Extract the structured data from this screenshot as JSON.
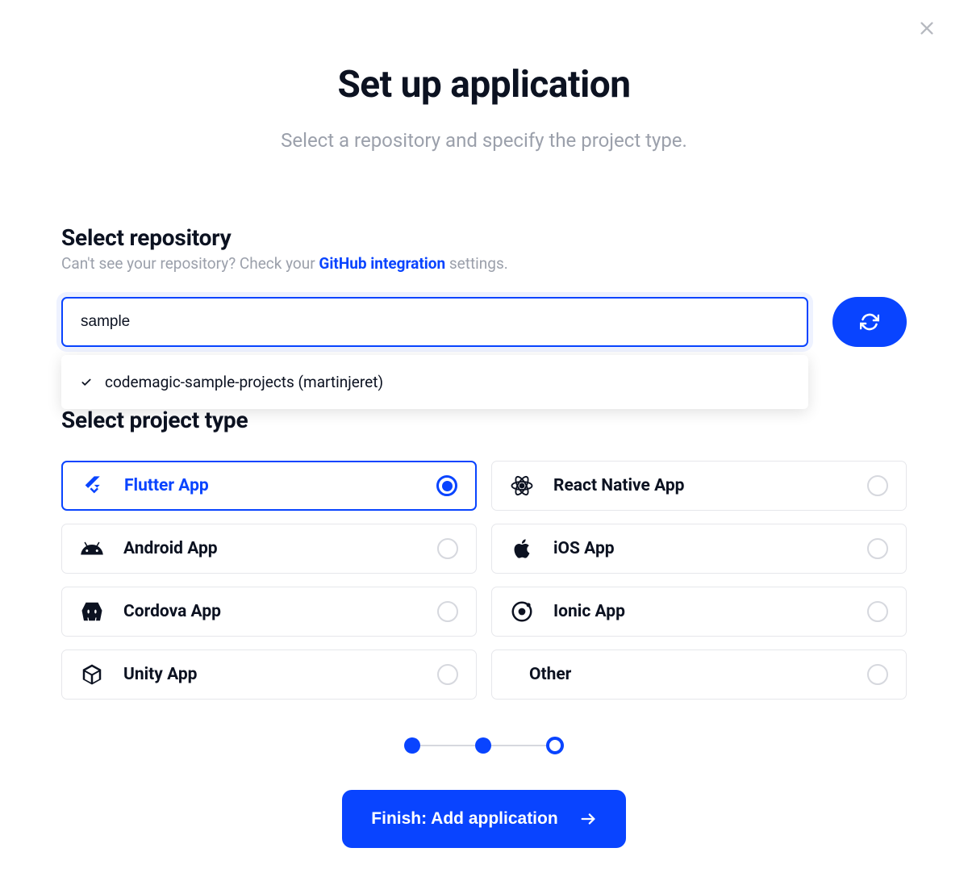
{
  "header": {
    "title": "Set up application",
    "subtitle": "Select a repository and specify the project type."
  },
  "repo": {
    "title": "Select repository",
    "help_prefix": "Can't see your repository? Check your ",
    "help_link": "GitHub integration",
    "help_suffix": " settings.",
    "input_value": "sample",
    "placeholder": "",
    "dropdown": [
      {
        "label": "codemagic-sample-projects (martinjeret)",
        "selected": true
      }
    ]
  },
  "project_type": {
    "title": "Select project type",
    "options": [
      {
        "icon": "flutter-icon",
        "label": "Flutter App",
        "selected": true
      },
      {
        "icon": "react-icon",
        "label": "React Native App",
        "selected": false
      },
      {
        "icon": "android-icon",
        "label": "Android App",
        "selected": false
      },
      {
        "icon": "apple-icon",
        "label": "iOS App",
        "selected": false
      },
      {
        "icon": "cordova-icon",
        "label": "Cordova App",
        "selected": false
      },
      {
        "icon": "ionic-icon",
        "label": "Ionic App",
        "selected": false
      },
      {
        "icon": "unity-icon",
        "label": "Unity App",
        "selected": false
      },
      {
        "icon": "",
        "label": "Other",
        "selected": false
      }
    ]
  },
  "stepper": {
    "steps": [
      {
        "state": "done"
      },
      {
        "state": "done"
      },
      {
        "state": "current"
      }
    ]
  },
  "finish": {
    "label": "Finish: Add application"
  },
  "colors": {
    "primary": "#0944ff",
    "text": "#0c1221",
    "muted": "#9ba0ab",
    "border": "#e6e7eb"
  }
}
